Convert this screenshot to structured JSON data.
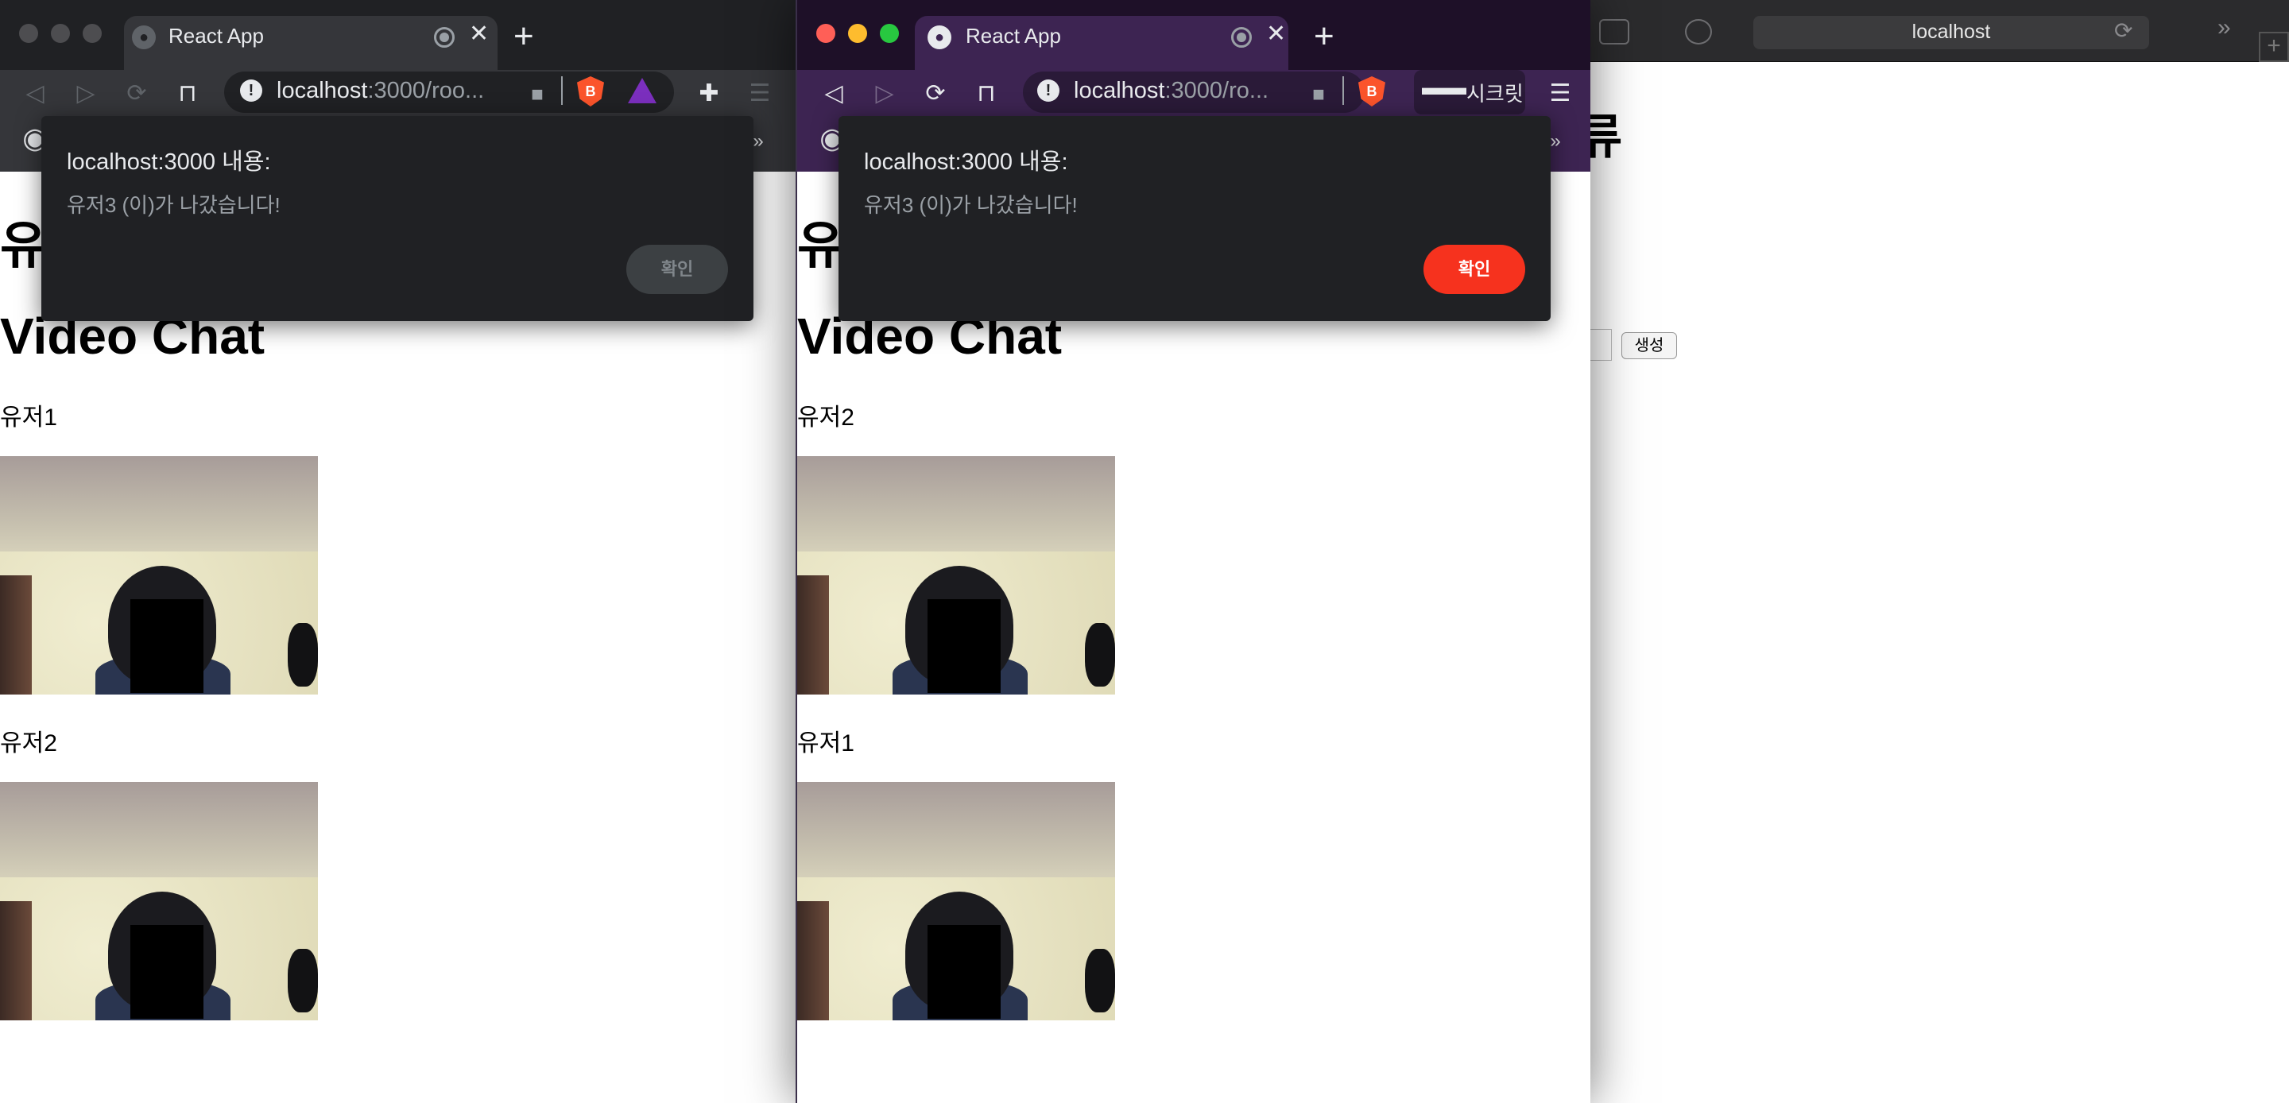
{
  "window_left": {
    "tab_title": "React App",
    "url_host": "localhost",
    "url_path": ":3000/roo...",
    "heading_partial": "유",
    "heading": "Video Chat",
    "users": [
      {
        "name": "유저1"
      },
      {
        "name": "유저2"
      }
    ],
    "dialog": {
      "title": "localhost:3000 내용:",
      "message": "유저3 (이)가 나갔습니다!",
      "ok_label": "확인",
      "ok_state": "disabled"
    }
  },
  "window_middle": {
    "tab_title": "React App",
    "url_host": "localhost",
    "url_path": ":3000/ro...",
    "private_label": "시크릿",
    "heading_partial": "유",
    "heading": "Video Chat",
    "users": [
      {
        "name": "유저2"
      },
      {
        "name": "유저1"
      }
    ],
    "dialog": {
      "title": "localhost:3000 내용:",
      "message": "유저3 (이)가 나갔습니다!",
      "ok_label": "확인",
      "ok_state": "active"
    },
    "bookmark_overflow": "»"
  },
  "window_right": {
    "address": "localhost",
    "heading_partial": "류",
    "create_button": "생성"
  },
  "colors": {
    "accent_active": "#f6321e",
    "dialog_bg": "#202124",
    "tabbar_private": "#1e1028"
  },
  "icons": [
    "back-icon",
    "forward-icon",
    "reload-icon",
    "bookmark-icon",
    "info-icon",
    "camera-icon",
    "brave-shield-icon",
    "extensions-icon",
    "menu-icon",
    "incognito-icon",
    "record-icon",
    "close-icon",
    "new-tab-icon",
    "github-icon"
  ]
}
